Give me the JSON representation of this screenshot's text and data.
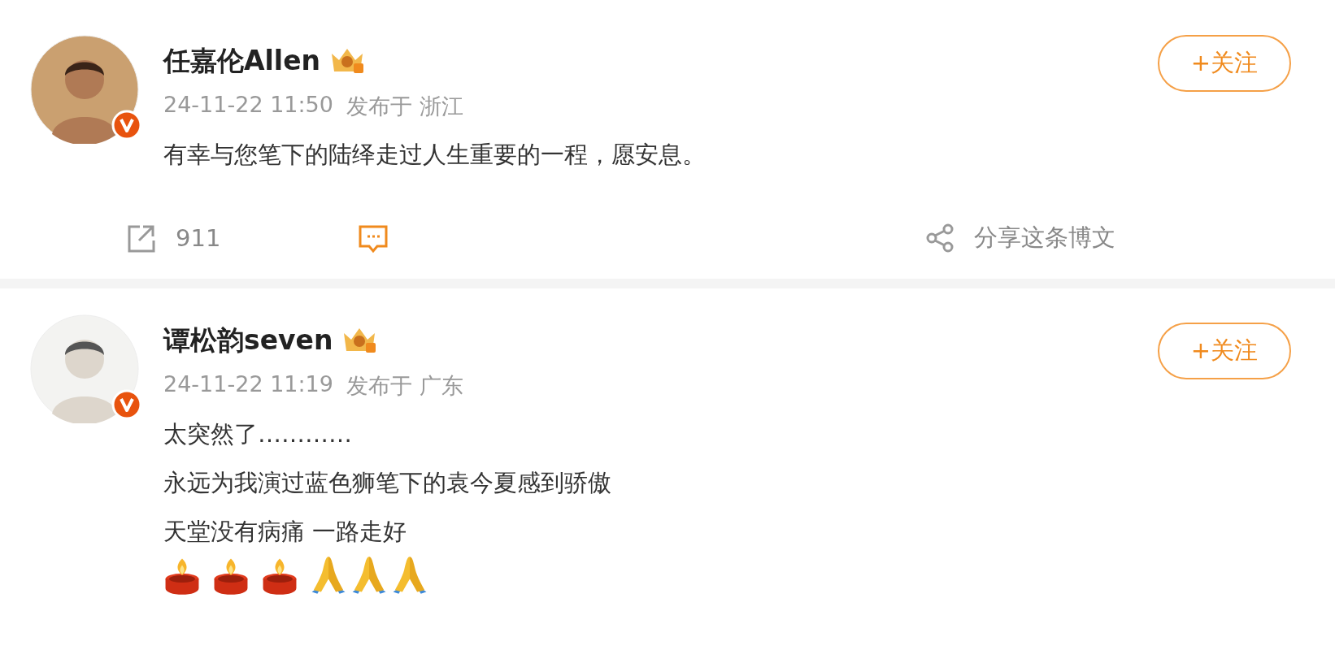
{
  "posts": [
    {
      "author": "任嘉伦Allen",
      "verified": true,
      "follow_label": "+关注",
      "date": "24-11-22 11:50",
      "location": "发布于 浙江",
      "lines": [
        "有幸与您笔下的陆绎走过人生重要的一程，愿安息。"
      ],
      "actions": {
        "repost_count": "911",
        "share_label": "分享这条博文"
      }
    },
    {
      "author": "谭松韵seven",
      "verified": true,
      "follow_label": "+关注",
      "date": "24-11-22 11:19",
      "location": "发布于 广东",
      "lines": [
        "太突然了…………",
        "永远为我演过蓝色狮笔下的袁今夏感到骄傲",
        "天堂没有病痛 一路走好"
      ],
      "emojis": [
        {
          "kind": "candle"
        },
        {
          "kind": "candle"
        },
        {
          "kind": "candle"
        },
        {
          "kind": "pray"
        },
        {
          "kind": "pray"
        },
        {
          "kind": "pray"
        }
      ]
    }
  ]
}
